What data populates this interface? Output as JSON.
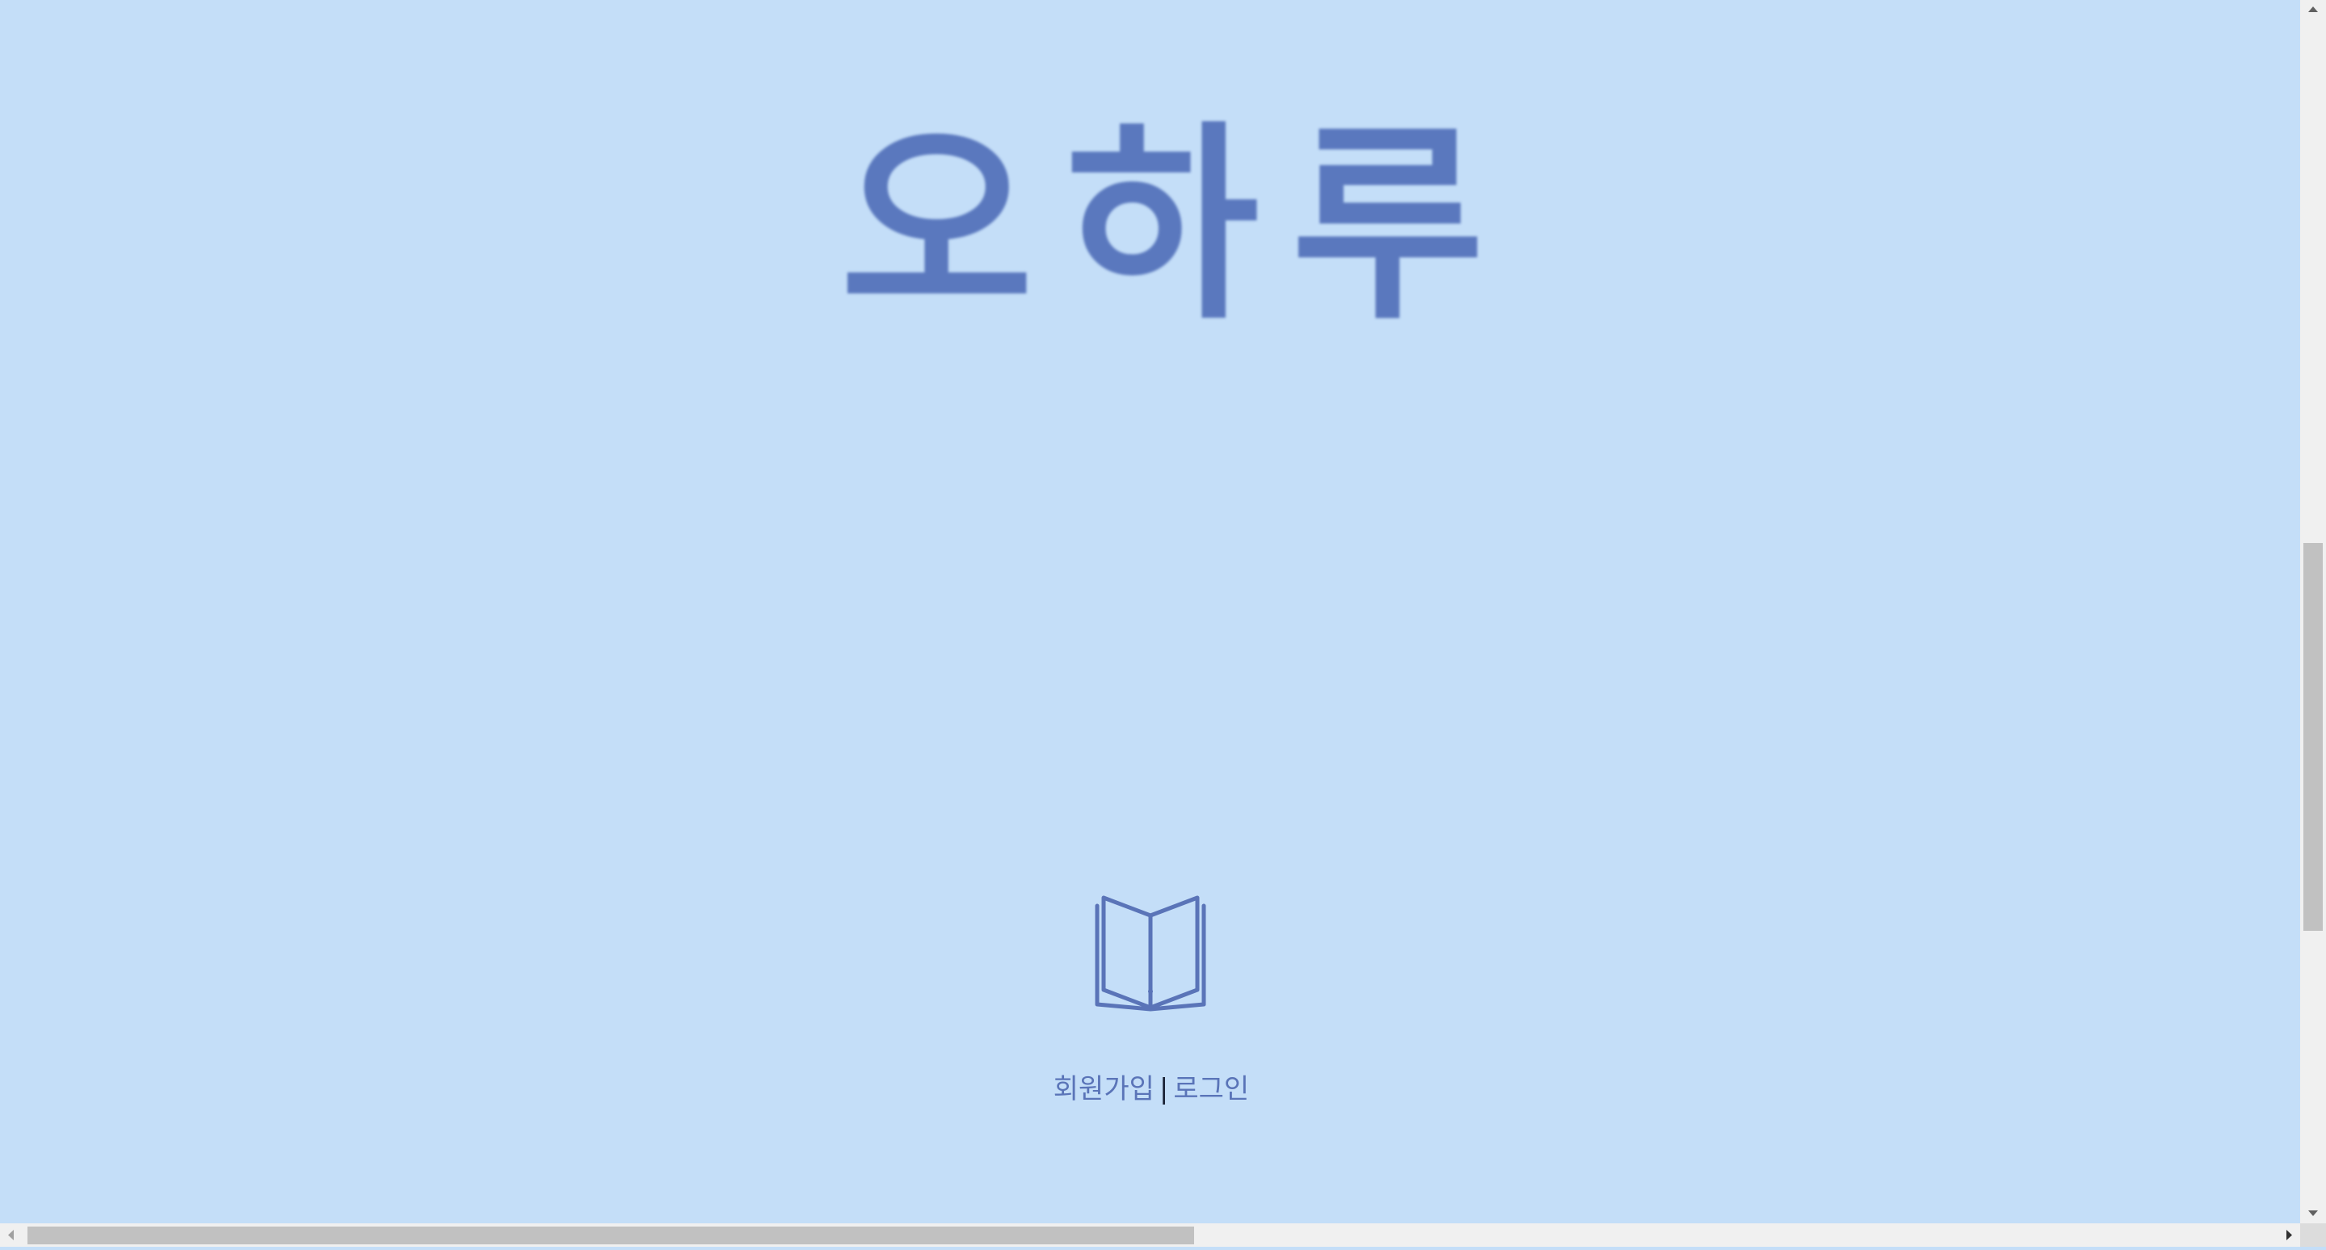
{
  "logo": {
    "text": "오하루"
  },
  "icons": {
    "book": "open-book-icon"
  },
  "auth": {
    "signup_label": "회원가입",
    "separator": "|",
    "login_label": "로그인"
  },
  "colors": {
    "background": "#c4def8",
    "accent": "#5a78be",
    "separator": "#1c2438"
  }
}
